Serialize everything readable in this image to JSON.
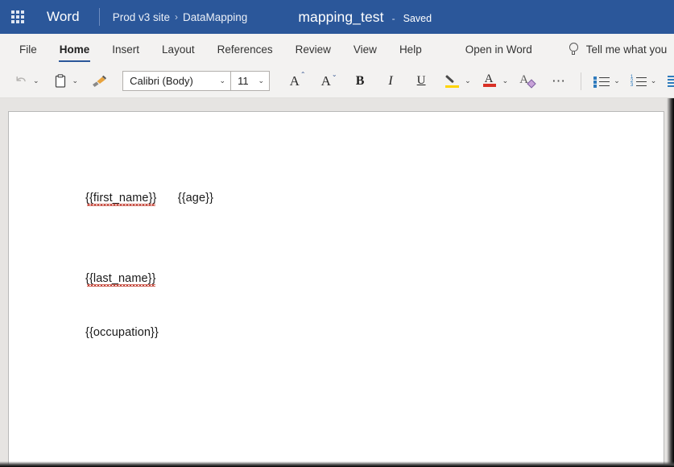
{
  "suite": {
    "app_launcher_icon": "waffle-grid-icon",
    "app_name": "Word",
    "breadcrumb": {
      "site": "Prod v3 site",
      "separator": "›",
      "folder": "DataMapping"
    },
    "document_title": "mapping_test",
    "dash": "-",
    "save_status": "Saved",
    "header_color": "#2b579a"
  },
  "ribbon": {
    "tabs": [
      {
        "label": "File",
        "active": false
      },
      {
        "label": "Home",
        "active": true
      },
      {
        "label": "Insert",
        "active": false
      },
      {
        "label": "Layout",
        "active": false
      },
      {
        "label": "References",
        "active": false
      },
      {
        "label": "Review",
        "active": false
      },
      {
        "label": "View",
        "active": false
      },
      {
        "label": "Help",
        "active": false
      }
    ],
    "open_in_word": "Open in Word",
    "tell_me": {
      "icon": "lightbulb-icon",
      "placeholder": "Tell me what you"
    },
    "active_tab_underline_color": "#2b579a"
  },
  "toolbar": {
    "undo": {
      "icon": "undo-icon",
      "label": "Undo"
    },
    "paste": {
      "icon": "clipboard-icon",
      "label": "Paste"
    },
    "format_painter": {
      "icon": "format-painter-icon",
      "label": "Format Painter"
    },
    "font_name": "Calibri (Body)",
    "font_size": "11",
    "grow_font": {
      "icon": "grow-font-icon",
      "label": "A"
    },
    "shrink_font": {
      "icon": "shrink-font-icon",
      "label": "A"
    },
    "bold": "B",
    "italic": "I",
    "underline": "U",
    "highlight": {
      "icon": "highlighter-icon",
      "color": "#ffd400"
    },
    "font_color": {
      "icon": "font-color-icon",
      "color": "#d93025"
    },
    "clear_formatting": {
      "icon": "clear-formatting-icon"
    },
    "more": "⋯",
    "bullets": {
      "icon": "bulleted-list-icon"
    },
    "numbering": {
      "icon": "numbered-list-icon",
      "markers": [
        "1",
        "2",
        "3"
      ]
    },
    "align": {
      "icon": "align-icon"
    }
  },
  "document": {
    "lines": [
      {
        "tokens": [
          {
            "text": "{{first_name}}",
            "misspelled": true
          },
          {
            "text": "{{age}}",
            "misspelled": false
          }
        ]
      },
      {
        "tokens": [
          {
            "text": "{{last_name}}",
            "misspelled": true
          }
        ]
      },
      {
        "tokens": [
          {
            "text": "{{occupation}}",
            "misspelled": false
          }
        ]
      }
    ]
  }
}
